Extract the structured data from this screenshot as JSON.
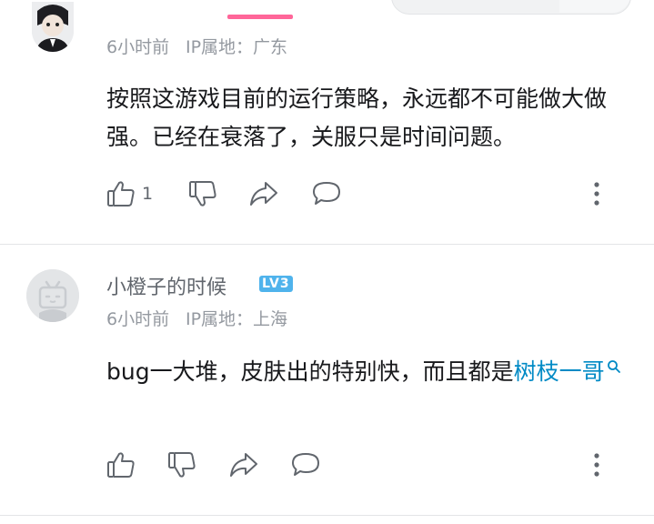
{
  "header": {
    "search_button_label": ""
  },
  "comments": [
    {
      "time": "6小时前",
      "ip": "IP属地：广东",
      "content": "按照这游戏目前的运行策略，永远都不可能做大做强。已经在衰落了，关服只是时间问题。",
      "like_count": "1"
    },
    {
      "username": "小橙子的时候",
      "level": "LV3",
      "time": "6小时前",
      "ip": "IP属地：上海",
      "content_prefix": "bug一大堆，皮肤出的特别快，而且都是",
      "content_link": "树枝一哥",
      "like_count": ""
    }
  ],
  "icons": {
    "like": "thumbs-up-icon",
    "dislike": "thumbs-down-icon",
    "share": "share-icon",
    "reply": "comment-icon",
    "more": "more-vertical-icon",
    "search": "search-icon"
  },
  "colors": {
    "accent_pink": "#ff6699",
    "link_blue": "#008ac5",
    "meta_gray": "#9499a0",
    "level_badge": "#4fb3ec"
  }
}
